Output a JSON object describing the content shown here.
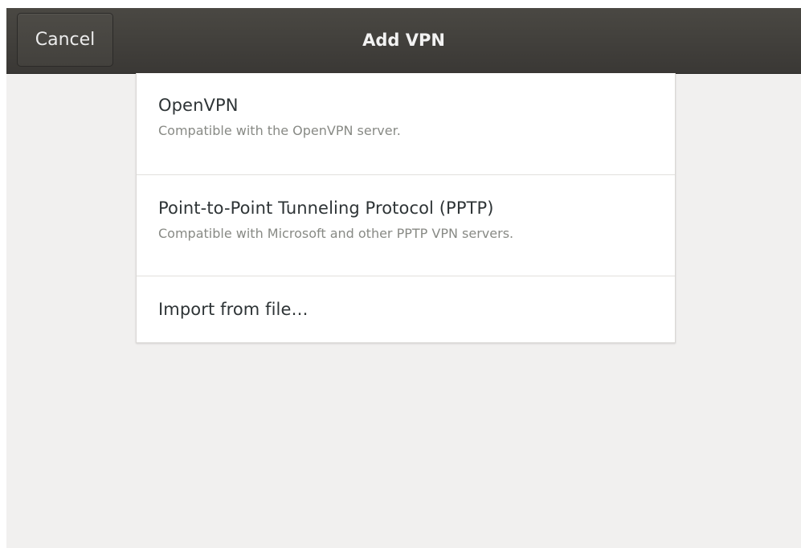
{
  "header": {
    "cancel_label": "Cancel",
    "title": "Add VPN"
  },
  "vpn_types": [
    {
      "title": "OpenVPN",
      "subtitle": "Compatible with the OpenVPN server."
    },
    {
      "title": "Point-to-Point Tunneling Protocol (PPTP)",
      "subtitle": "Compatible with Microsoft and other PPTP VPN servers."
    }
  ],
  "import": {
    "label": "Import from file…"
  }
}
